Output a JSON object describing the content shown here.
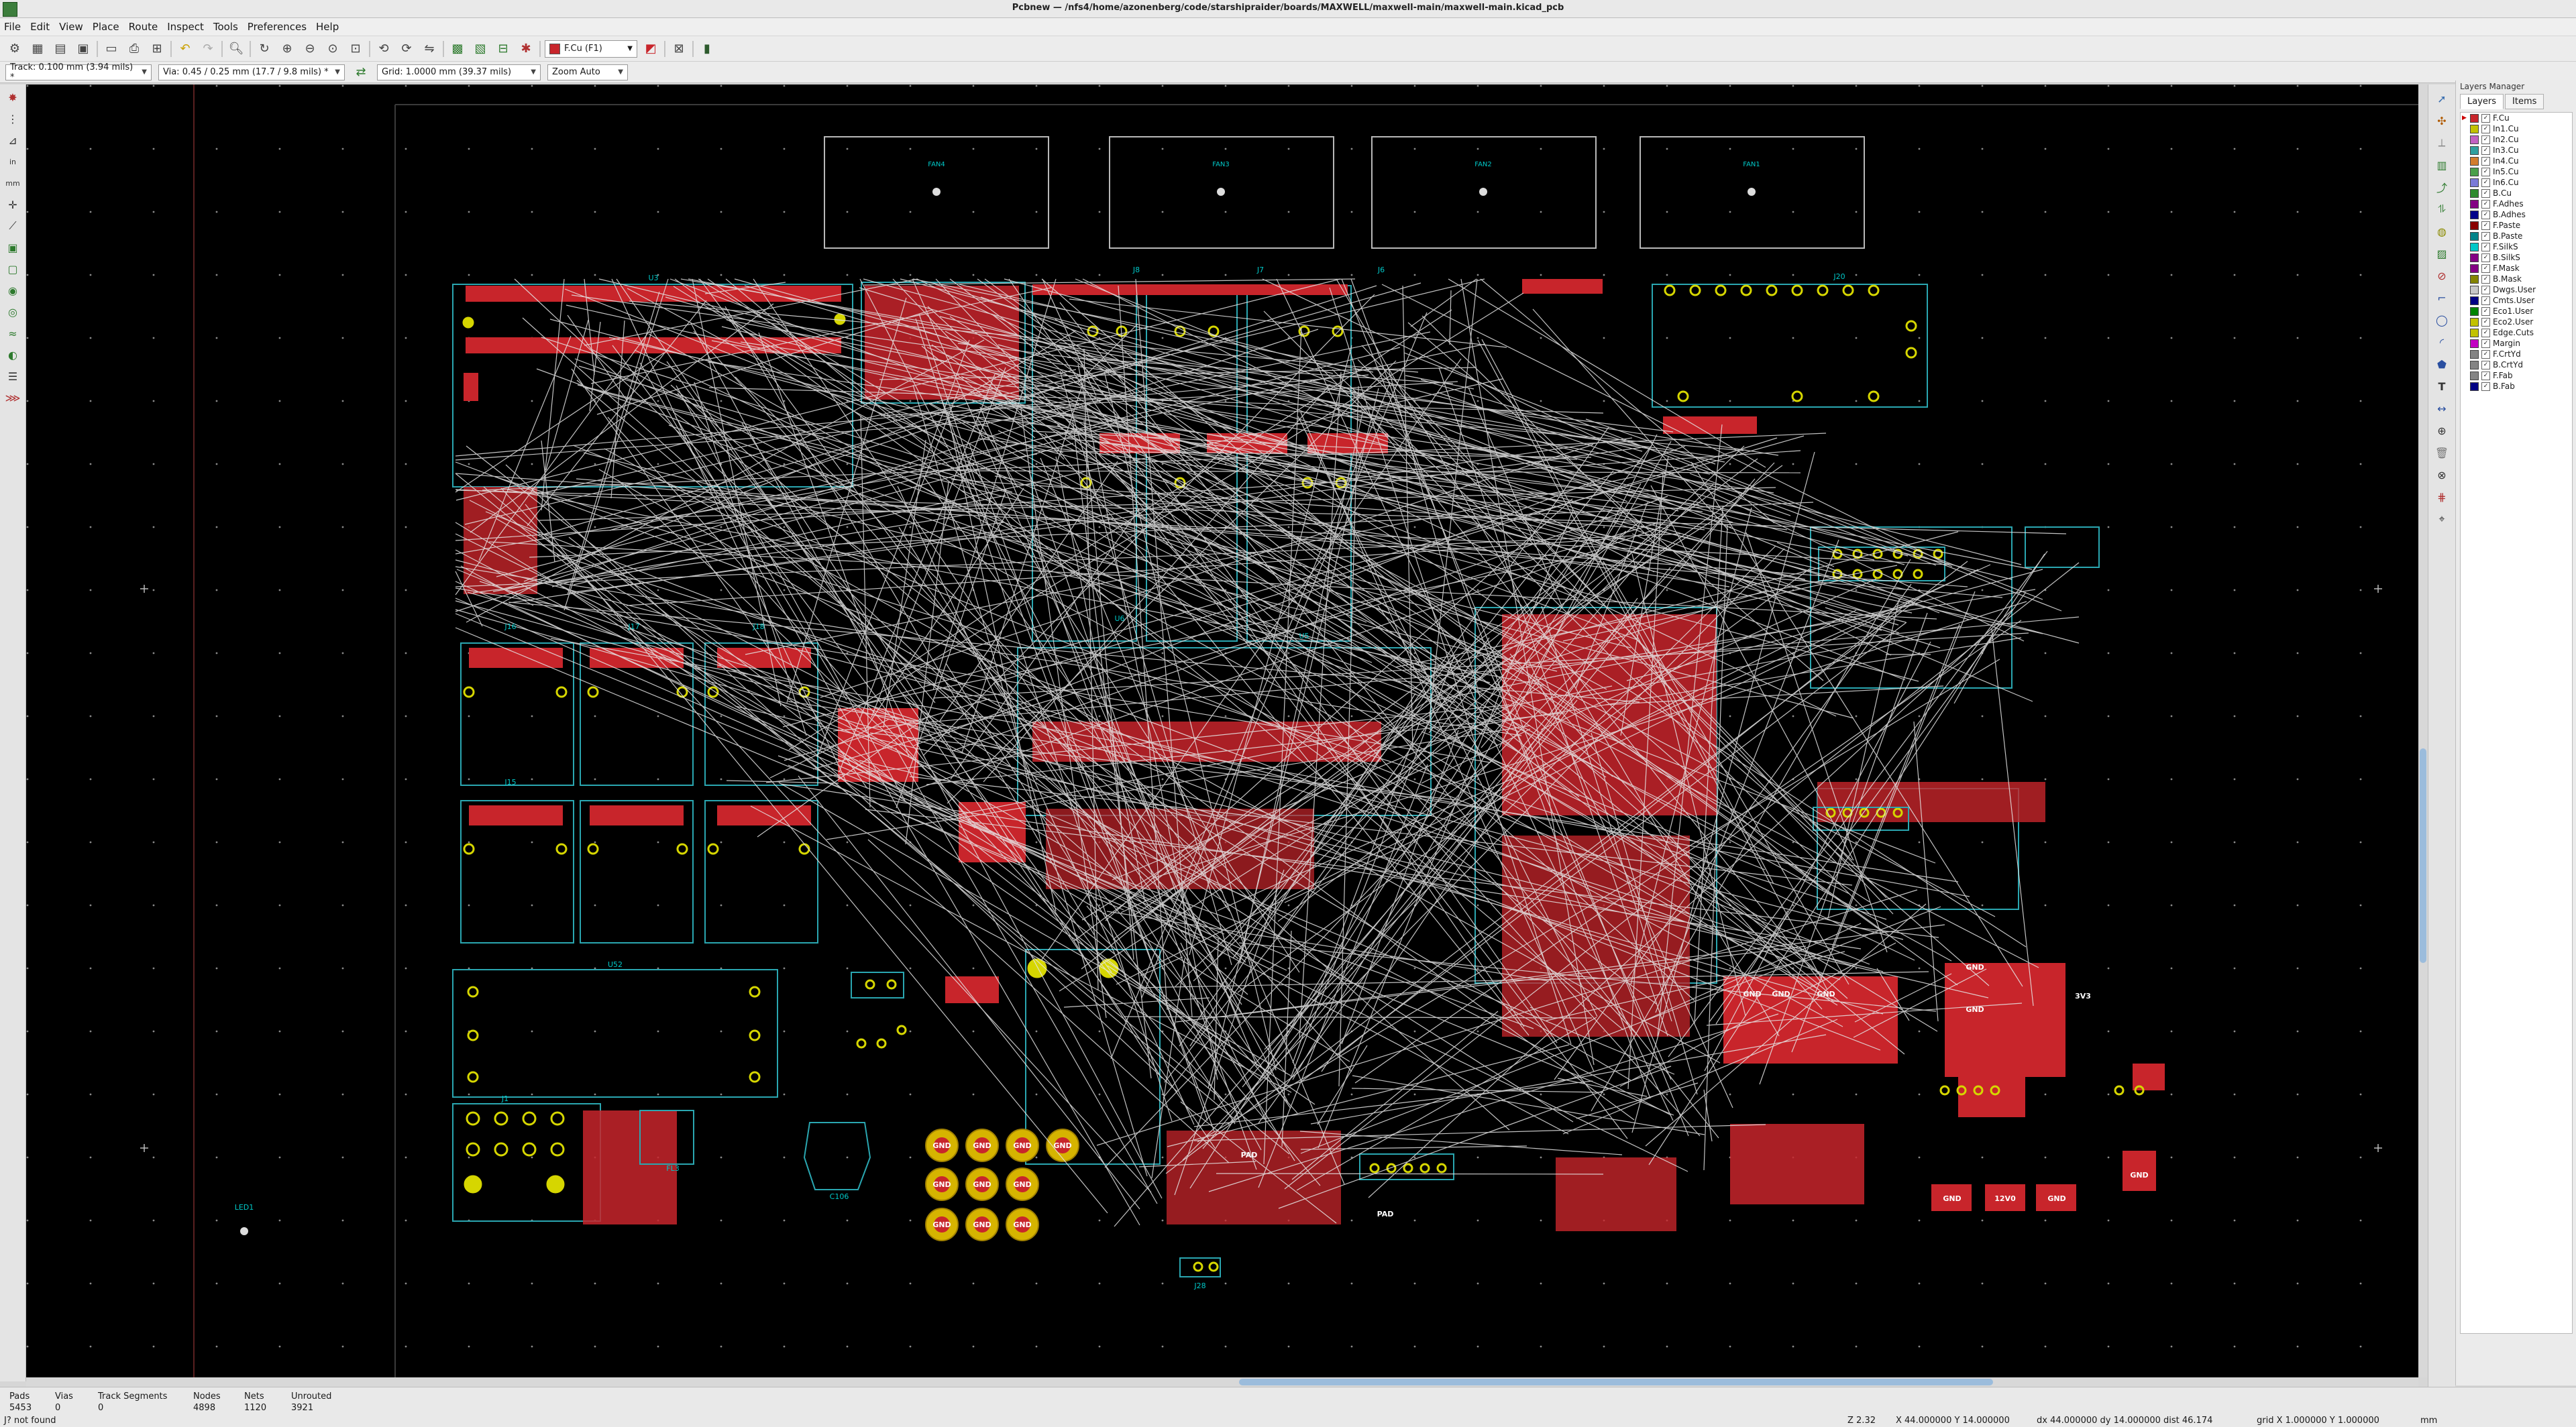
{
  "window": {
    "title": "Pcbnew — /nfs4/home/azonenberg/code/starshipraider/boards/MAXWELL/maxwell-main/maxwell-main.kicad_pcb"
  },
  "menu": [
    "File",
    "Edit",
    "View",
    "Place",
    "Route",
    "Inspect",
    "Tools",
    "Preferences",
    "Help"
  ],
  "toolbar": {
    "active_layer": "F.Cu (F1)",
    "active_layer_color": "#c8252b"
  },
  "toolbar2": {
    "track": "Track: 0.100 mm (3.94 mils) *",
    "via": "Via: 0.45 / 0.25 mm (17.7 / 9.8 mils) *",
    "grid": "Grid: 1.0000 mm (39.37 mils)",
    "zoom": "Zoom Auto"
  },
  "layers_manager": {
    "title": "Layers Manager",
    "tabs": [
      "Layers",
      "Items"
    ],
    "active_tab": "Layers",
    "layers": [
      {
        "name": "F.Cu",
        "color": "#c8252b",
        "active": true
      },
      {
        "name": "In1.Cu",
        "color": "#c2c200"
      },
      {
        "name": "In2.Cu",
        "color": "#c261c2"
      },
      {
        "name": "In3.Cu",
        "color": "#2f9f9f"
      },
      {
        "name": "In4.Cu",
        "color": "#d27d2c"
      },
      {
        "name": "In5.Cu",
        "color": "#4aa04a"
      },
      {
        "name": "In6.Cu",
        "color": "#7a7ad8"
      },
      {
        "name": "B.Cu",
        "color": "#2e8b2e"
      },
      {
        "name": "F.Adhes",
        "color": "#840084"
      },
      {
        "name": "B.Adhes",
        "color": "#00008a"
      },
      {
        "name": "F.Paste",
        "color": "#8a0000"
      },
      {
        "name": "B.Paste",
        "color": "#00848a"
      },
      {
        "name": "F.SilkS",
        "color": "#00c8c8"
      },
      {
        "name": "B.SilkS",
        "color": "#840084"
      },
      {
        "name": "F.Mask",
        "color": "#840084"
      },
      {
        "name": "B.Mask",
        "color": "#848400"
      },
      {
        "name": "Dwgs.User",
        "color": "#c8c8c8"
      },
      {
        "name": "Cmts.User",
        "color": "#000084"
      },
      {
        "name": "Eco1.User",
        "color": "#008400"
      },
      {
        "name": "Eco2.User",
        "color": "#c2c200"
      },
      {
        "name": "Edge.Cuts",
        "color": "#c2c200"
      },
      {
        "name": "Margin",
        "color": "#c200c2"
      },
      {
        "name": "F.CrtYd",
        "color": "#848484"
      },
      {
        "name": "B.CrtYd",
        "color": "#848484"
      },
      {
        "name": "F.Fab",
        "color": "#848484"
      },
      {
        "name": "B.Fab",
        "color": "#000084"
      }
    ]
  },
  "board": {
    "fans": [
      "FAN4",
      "FAN3",
      "FAN2",
      "FAN1"
    ],
    "refs": [
      "U3",
      "J8",
      "J7",
      "J6",
      "J20",
      "J16",
      "J17",
      "J18",
      "J15",
      "U52",
      "U5",
      "J1",
      "FL3",
      "C106",
      "J28",
      "U6",
      "LED1"
    ],
    "pad_labels": [
      "GND",
      "12V0",
      "PAD",
      "3V3"
    ]
  },
  "status": {
    "stats": [
      {
        "label": "Pads",
        "value": "5453"
      },
      {
        "label": "Vias",
        "value": "0"
      },
      {
        "label": "Track Segments",
        "value": "0"
      },
      {
        "label": "Nodes",
        "value": "4898"
      },
      {
        "label": "Nets",
        "value": "1120"
      },
      {
        "label": "Unrouted",
        "value": "3921"
      }
    ],
    "message": "J? not found",
    "zoom": "Z 2.32",
    "xy": "X 44.000000  Y 14.000000",
    "delta": "dx 44.000000  dy 14.000000  dist 46.174",
    "grid": "grid X 1.000000  Y 1.000000",
    "units": "mm"
  }
}
